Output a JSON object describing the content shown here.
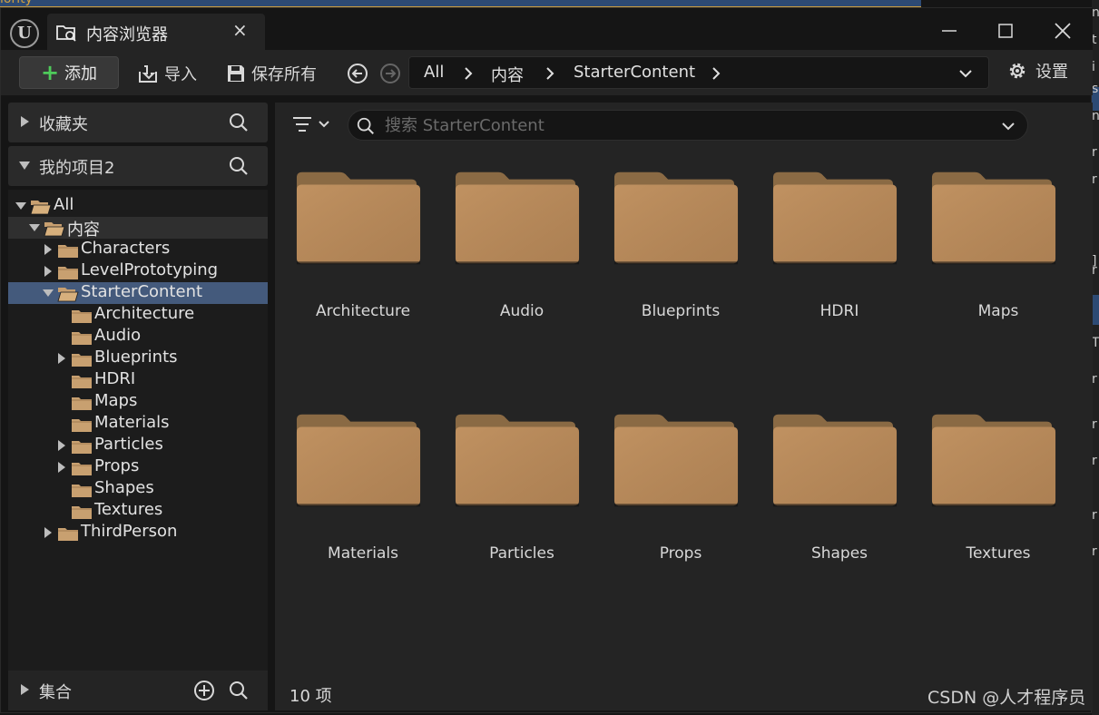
{
  "window": {
    "tab_title": "内容浏览器",
    "tab_close": "×",
    "minimize": "—",
    "maximize": "☐",
    "close": "✕"
  },
  "toolbar": {
    "add_label": "添加",
    "import_label": "导入",
    "save_all_label": "保存所有",
    "breadcrumb": [
      "All",
      "内容",
      "StarterContent"
    ],
    "settings_label": "设置"
  },
  "sidebar": {
    "favorites_label": "收藏夹",
    "project_label": "我的项目2",
    "collections_label": "集合",
    "tree": [
      {
        "label": "All",
        "depth": 0,
        "expanded": true,
        "has_children": true,
        "selected": ""
      },
      {
        "label": "内容",
        "depth": 1,
        "expanded": true,
        "has_children": true,
        "selected": "dim"
      },
      {
        "label": "Characters",
        "depth": 2,
        "expanded": false,
        "has_children": true,
        "selected": ""
      },
      {
        "label": "LevelPrototyping",
        "depth": 2,
        "expanded": false,
        "has_children": true,
        "selected": ""
      },
      {
        "label": "StarterContent",
        "depth": 2,
        "expanded": true,
        "has_children": true,
        "selected": "active"
      },
      {
        "label": "Architecture",
        "depth": 3,
        "expanded": false,
        "has_children": false,
        "selected": ""
      },
      {
        "label": "Audio",
        "depth": 3,
        "expanded": false,
        "has_children": false,
        "selected": ""
      },
      {
        "label": "Blueprints",
        "depth": 3,
        "expanded": false,
        "has_children": true,
        "selected": ""
      },
      {
        "label": "HDRI",
        "depth": 3,
        "expanded": false,
        "has_children": false,
        "selected": ""
      },
      {
        "label": "Maps",
        "depth": 3,
        "expanded": false,
        "has_children": false,
        "selected": ""
      },
      {
        "label": "Materials",
        "depth": 3,
        "expanded": false,
        "has_children": false,
        "selected": ""
      },
      {
        "label": "Particles",
        "depth": 3,
        "expanded": false,
        "has_children": true,
        "selected": ""
      },
      {
        "label": "Props",
        "depth": 3,
        "expanded": false,
        "has_children": true,
        "selected": ""
      },
      {
        "label": "Shapes",
        "depth": 3,
        "expanded": false,
        "has_children": false,
        "selected": ""
      },
      {
        "label": "Textures",
        "depth": 3,
        "expanded": false,
        "has_children": false,
        "selected": ""
      },
      {
        "label": "ThirdPerson",
        "depth": 2,
        "expanded": false,
        "has_children": true,
        "selected": ""
      }
    ]
  },
  "content": {
    "search_placeholder": "搜索 StarterContent",
    "folders": [
      "Architecture",
      "Audio",
      "Blueprints",
      "HDRI",
      "Maps",
      "Materials",
      "Particles",
      "Props",
      "Shapes",
      "Textures"
    ],
    "item_count": "10 项"
  },
  "watermark": "CSDN @人才程序员",
  "background_fragments": {
    "top_left_text": "lority",
    "right_glyphs": [
      "n",
      "t",
      "i",
      "s",
      "n",
      "r",
      "r",
      "]",
      "r",
      "T",
      "r",
      "r",
      "r",
      "r",
      "r"
    ]
  },
  "colors": {
    "folder": "#b8895a",
    "selection": "#445a7c",
    "add_plus": "#4ecb5a"
  }
}
